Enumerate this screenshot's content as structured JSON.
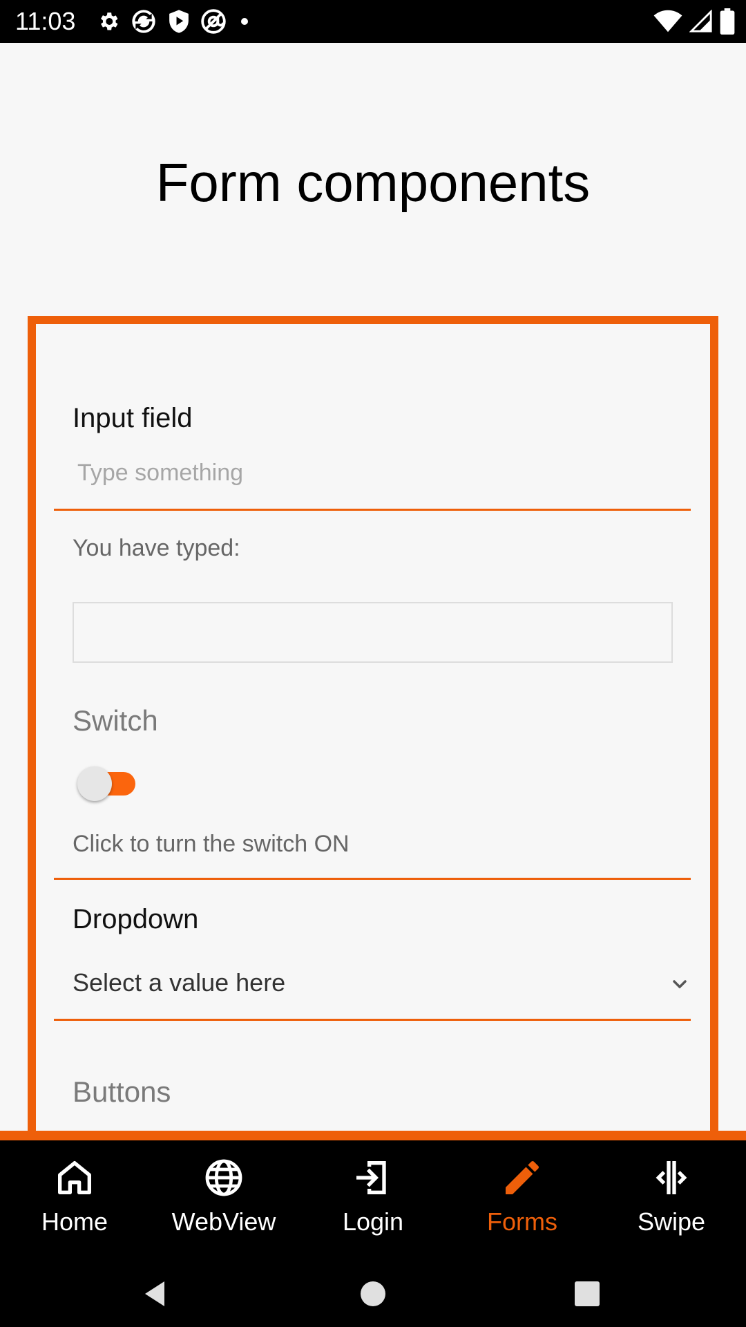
{
  "status_bar": {
    "time": "11:03",
    "left_icons": [
      "gear-icon",
      "sync-icon",
      "shield-play-icon",
      "at-sign-icon",
      "dot-icon"
    ],
    "right_icons": [
      "wifi-icon",
      "signal-icon",
      "battery-icon"
    ]
  },
  "page": {
    "title": "Form components"
  },
  "form": {
    "input_label": "Input field",
    "input_placeholder": "Type something",
    "input_value": "",
    "typed_label": "You have typed:",
    "typed_value": "",
    "switch_label": "Switch",
    "switch_on": false,
    "switch_hint": "Click to turn the switch ON",
    "dropdown_label": "Dropdown",
    "dropdown_value": "Select a value here",
    "buttons_label": "Buttons"
  },
  "bottom_nav": {
    "items": [
      {
        "label": "Home",
        "icon": "home-icon",
        "active": false
      },
      {
        "label": "WebView",
        "icon": "globe-icon",
        "active": false
      },
      {
        "label": "Login",
        "icon": "login-icon",
        "active": false
      },
      {
        "label": "Forms",
        "icon": "pencil-icon",
        "active": true
      },
      {
        "label": "Swipe",
        "icon": "swipe-icon",
        "active": false
      }
    ]
  },
  "system_nav": [
    "back-icon",
    "home-circle-icon",
    "recents-icon"
  ],
  "colors": {
    "accent": "#ee5f0a",
    "switch_track": "#fb650d",
    "background": "#f7f7f7"
  }
}
